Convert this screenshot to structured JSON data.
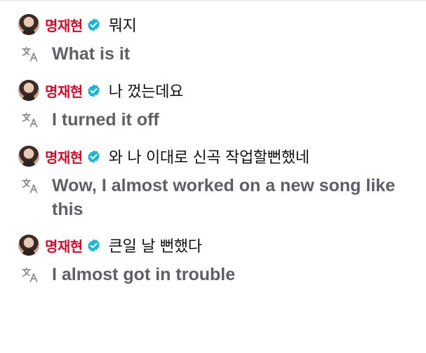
{
  "colors": {
    "username": "#c8102e",
    "verified_badge": "#1fb3d6",
    "translation_text": "#5f5f66",
    "original_text": "#111111"
  },
  "icons": {
    "verified": "verified-badge-icon",
    "translate": "translate-icon",
    "avatar": "user-avatar"
  },
  "messages": [
    {
      "username": "명재현",
      "original": "뭐지",
      "translation": "What is it"
    },
    {
      "username": "명재현",
      "original": "나 껐는데요",
      "translation": "I turned it off"
    },
    {
      "username": "명재현",
      "original": "와 나 이대로 신곡 작업할뻔했네",
      "translation": "Wow, I almost worked on a new song like this"
    },
    {
      "username": "명재현",
      "original": "큰일 날 뻔했다",
      "translation": "I almost got in trouble"
    }
  ]
}
